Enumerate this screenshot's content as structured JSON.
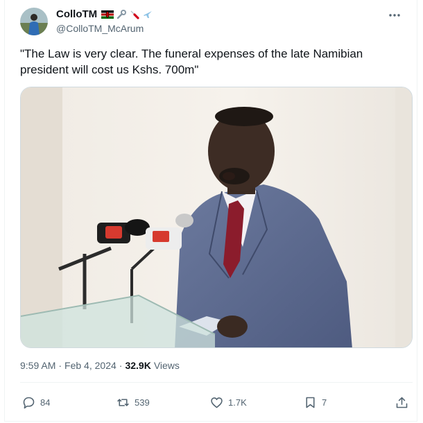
{
  "author": {
    "display_name": "ColloTM",
    "handle": "@ColloTM_McArum",
    "badge_icons": [
      "kenya-flag-icon",
      "wrench-icon",
      "screwdriver-icon",
      "airplane-icon"
    ]
  },
  "tweet": {
    "text": "\"The Law is very clear. The funeral expenses of the late Namibian president will cost us Kshs. 700m\"",
    "time": "9:59 AM",
    "separator": "·",
    "date": "Feb 4, 2024",
    "views_count": "32.9K",
    "views_label": "Views"
  },
  "actions": {
    "replies": "84",
    "reposts": "539",
    "likes": "1.7K",
    "bookmarks": "7"
  },
  "colors": {
    "text": "#0f1419",
    "secondary": "#536471",
    "border": "#eff3f4"
  }
}
